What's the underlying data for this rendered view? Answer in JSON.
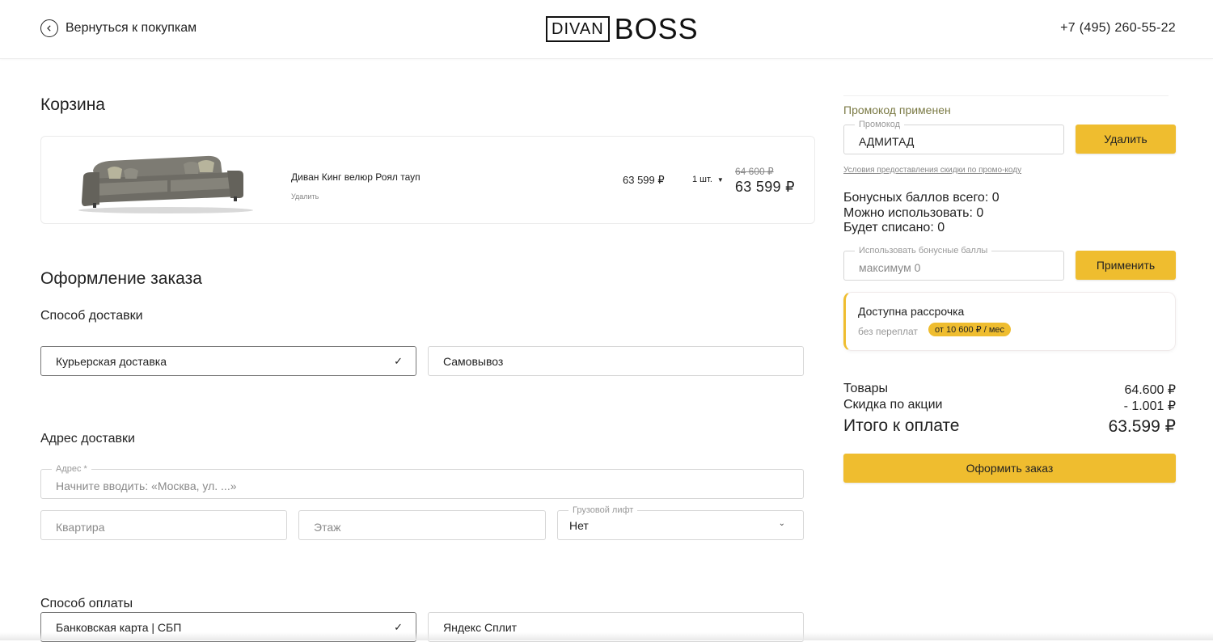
{
  "header": {
    "back_label": "Вернуться к покупкам",
    "logo_box": "DIVAN",
    "logo_text": "BOSS",
    "phone": "+7 (495) 260-55-22"
  },
  "cart": {
    "title": "Корзина",
    "item": {
      "name": "Диван Кинг велюр Роял тауп",
      "delete_label": "Удалить",
      "price": "63 599 ₽",
      "quantity": "1 шт.",
      "old_price": "64 600 ₽",
      "total": "63 599 ₽"
    }
  },
  "order": {
    "title": "Оформление заказа",
    "delivery_title": "Способ доставки",
    "delivery_options": [
      "Курьерская доставка",
      "Самовывоз"
    ],
    "delivery_selected": "Курьерская доставка",
    "address_title": "Адрес доставки",
    "address_label": "Адрес *",
    "address_placeholder": "Начните вводить: «Москва, ул. ...»",
    "apartment_placeholder": "Квартира",
    "floor_placeholder": "Этаж",
    "elevator_label": "Грузовой лифт",
    "elevator_value": "Нет",
    "payment_title": "Способ оплаты",
    "payment_options": [
      "Банковская карта | СБП",
      "Яндекс Сплит"
    ],
    "payment_selected": "Банковская карта | СБП"
  },
  "side": {
    "promo_status": "Промокод применен",
    "promo_label": "Промокод",
    "promo_value": "АДМИТАД",
    "promo_delete": "Удалить",
    "promo_terms": "Условия предоставления скидки по промо-коду",
    "bonus_total": "Бонусных баллов всего: 0",
    "bonus_available": "Можно использовать: 0",
    "bonus_spent": "Будет списано: 0",
    "bonus_label": "Использовать бонусные баллы",
    "bonus_placeholder": "максимум 0",
    "bonus_apply": "Применить",
    "installment_title": "Доступна рассрочка",
    "installment_sub": "без переплат",
    "installment_badge": "от 10 600 ₽ / мес",
    "goods_label": "Товары",
    "goods_value": "64.600 ₽",
    "discount_label": "Скидка по акции",
    "discount_value": "- 1.001 ₽",
    "total_label": "Итого к оплате",
    "total_value": "63.599 ₽",
    "checkout": "Оформить заказ"
  },
  "colors": {
    "accent": "#efbd2f",
    "promo_status": "#7b7a45"
  }
}
